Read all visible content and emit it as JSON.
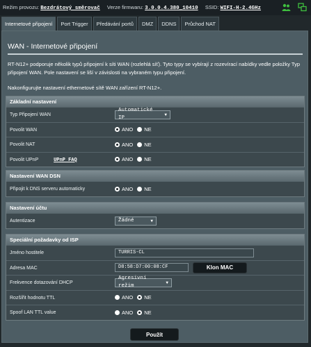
{
  "topbar": {
    "mode_label": "Režim provozu:",
    "mode_value": "Bezdrátový směrovač",
    "firmware_label": "Verze firmwaru:",
    "firmware_value": "3.0.0.4.380_10410",
    "ssid_label": "SSID:",
    "ssid_value": "WIFI-H-2.4GHz",
    "icons": [
      "users-icon",
      "network-status-icon"
    ]
  },
  "tabs": [
    {
      "label": "Internetové připojení",
      "active": true
    },
    {
      "label": "Port Trigger"
    },
    {
      "label": "Předávání portů"
    },
    {
      "label": "DMZ"
    },
    {
      "label": "DDNS"
    },
    {
      "label": "Průchod NAT"
    }
  ],
  "page": {
    "title": "WAN - Internetové připojení",
    "description": "RT-N12+ podporuje několik typů připojení k síti WAN (rozlehlá síť). Tyto typy se vybírají z rozevírací nabídky vedle položky Typ připojení WAN. Pole nastavení se liší v závislosti na vybraném typu připojení.",
    "note": "Nakonfigurujte nastavení ethernetové sítě WAN zařízení RT-N12+."
  },
  "sections": {
    "basic": {
      "header": "Základní nastavení",
      "wan_type_label": "Typ Připojení WAN",
      "wan_type_value": "Automatické IP",
      "enable_wan_label": "Povolit WAN",
      "enable_nat_label": "Povolit NAT",
      "enable_upnp_label": "Povolit UPnP",
      "upnp_faq": "UPnP FAQ"
    },
    "dns": {
      "header": "Nastavení WAN DSN",
      "auto_dns_label": "Připojit k DNS serveru automaticky"
    },
    "account": {
      "header": "Nastavení účtu",
      "auth_label": "Autentizace",
      "auth_value": "Žádné"
    },
    "isp": {
      "header": "Speciální požadavky od ISP",
      "hostname_label": "Jméno hostitele",
      "hostname_value": "TURRIS-CL",
      "mac_label": "Adresa MAC",
      "mac_value": "D8:58:D7:00:08:CF",
      "clone_mac": "Klon MAC",
      "dhcp_label": "Frekvence dotazování DHCP",
      "dhcp_value": "Agresivní režim",
      "ttl_label": "Rozšířit hodnotu TTL",
      "spoof_ttl_label": "Spoof LAN TTL value"
    }
  },
  "radio": {
    "yes": "ANO",
    "no": "NE"
  },
  "apply_button": "Použít",
  "colors": {
    "background": "#21282b",
    "panel": "#4d5d64",
    "header": "#6b7a80"
  }
}
